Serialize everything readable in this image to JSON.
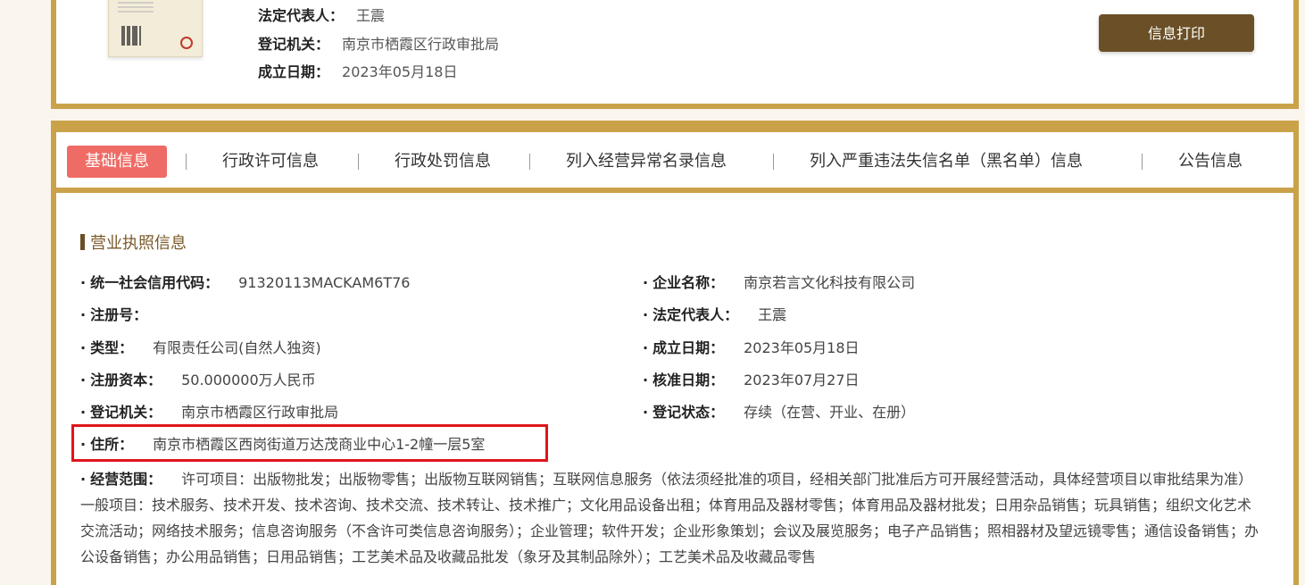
{
  "top": {
    "legal_rep_label": "法定代表人：",
    "legal_rep_value": "王震",
    "reg_authority_label": "登记机关：",
    "reg_authority_value": "南京市栖霞区行政审批局",
    "established_label": "成立日期：",
    "established_value": "2023年05月18日",
    "print_button": "信息打印"
  },
  "tabs": [
    "基础信息",
    "行政许可信息",
    "行政处罚信息",
    "列入经营异常名录信息",
    "列入严重违法失信名单（黑名单）信息",
    "公告信息"
  ],
  "section_title": "营业执照信息",
  "bullet": "·",
  "left_fields": [
    {
      "label": "统一社会信用代码：",
      "value": "91320113MACKAM6T76"
    },
    {
      "label": "注册号：",
      "value": ""
    },
    {
      "label": "类型：",
      "value": "有限责任公司(自然人独资)"
    },
    {
      "label": "注册资本：",
      "value": "50.000000万人民币"
    },
    {
      "label": "登记机关：",
      "value": "南京市栖霞区行政审批局"
    },
    {
      "label": "住所：",
      "value": "南京市栖霞区西岗街道万达茂商业中心1-2幢一层5室"
    }
  ],
  "right_fields": [
    {
      "label": "企业名称：",
      "value": "南京若言文化科技有限公司"
    },
    {
      "label": "法定代表人：",
      "value": "王震"
    },
    {
      "label": "成立日期：",
      "value": "2023年05月18日"
    },
    {
      "label": "核准日期：",
      "value": "2023年07月27日"
    },
    {
      "label": "登记状态：",
      "value": "存续（在营、开业、在册）"
    }
  ],
  "scope": {
    "label": "经营范围：",
    "value": "许可项目：出版物批发；出版物零售；出版物互联网销售；互联网信息服务（依法须经批准的项目，经相关部门批准后方可开展经营活动，具体经营项目以审批结果为准） 一般项目：技术服务、技术开发、技术咨询、技术交流、技术转让、技术推广；文化用品设备出租；体育用品及器材零售；体育用品及器材批发；日用杂品销售；玩具销售；组织文化艺术交流活动；网络技术服务；信息咨询服务（不含许可类信息咨询服务）；企业管理；软件开发；企业形象策划；会议及展览服务；电子产品销售；照相器材及望远镜零售；通信设备销售；办公设备销售；办公用品销售；日用品销售；工艺美术品及收藏品批发（象牙及其制品除外）；工艺美术品及收藏品零售"
  },
  "colors": {
    "gold_border": "#c9a24a",
    "button_brown": "#6b4f26",
    "active_tab": "#ef6b65",
    "highlight_red": "#e0151b"
  }
}
